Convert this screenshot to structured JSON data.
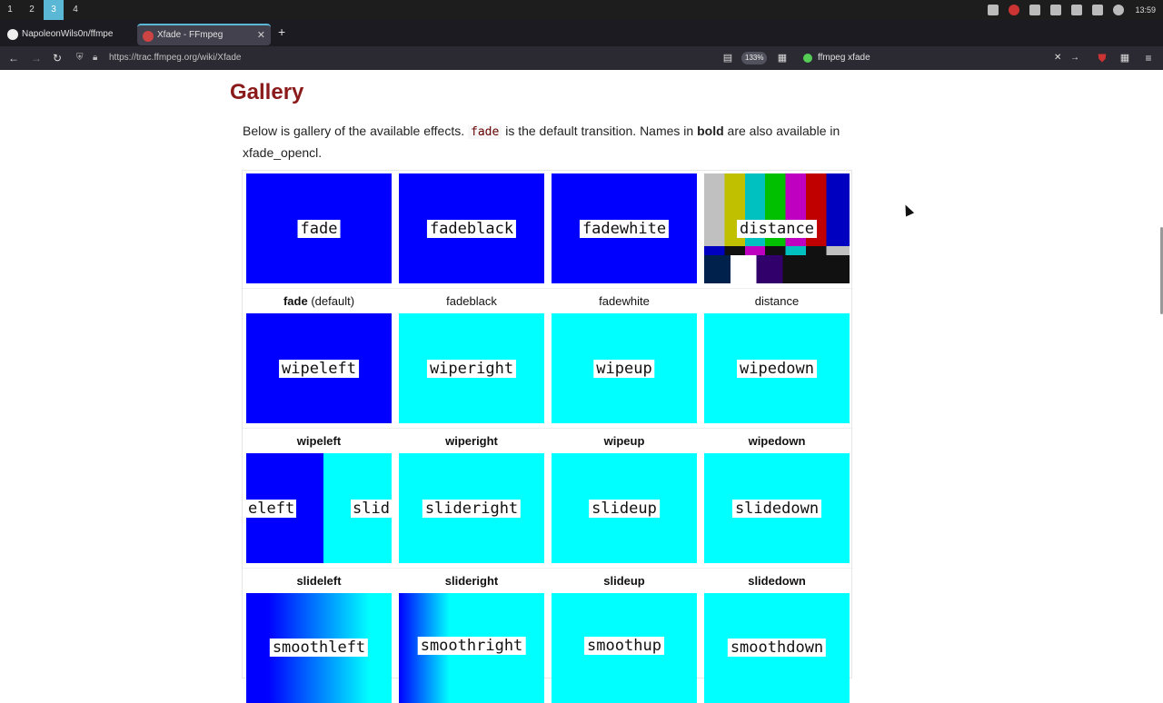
{
  "taskbar": {
    "workspaces": [
      "1",
      "2",
      "3",
      "4"
    ],
    "active_workspace": "3",
    "clock": "13:59"
  },
  "tabs": [
    {
      "label": "NapoleonWils0n/ffmpe",
      "active": false
    },
    {
      "label": "Xfade - FFmpeg",
      "active": true
    }
  ],
  "navbar": {
    "url": "https://trac.ffmpeg.org/wiki/Xfade",
    "zoom": "133%",
    "search": "ffmpeg xfade"
  },
  "page": {
    "heading": "Gallery",
    "intro_before": "Below is gallery of the available effects.",
    "intro_code": "fade",
    "intro_mid": "is the default transition. Names in",
    "intro_bold": "bold",
    "intro_after": "are also available in xfade_opencl."
  },
  "gallery": {
    "rows": [
      [
        {
          "tile": "fade",
          "caption": "fade",
          "caption_suffix": "(default)",
          "bold": true
        },
        {
          "tile": "fadeblack",
          "caption": "fadeblack",
          "bold": false
        },
        {
          "tile": "fadewhite",
          "caption": "fadewhite",
          "bold": false
        },
        {
          "tile": "distance",
          "caption": "distance",
          "bold": false
        }
      ],
      [
        {
          "tile": "wipeleft",
          "caption": "wipeleft",
          "bold": true
        },
        {
          "tile": "wiperight",
          "caption": "wiperight",
          "bold": true
        },
        {
          "tile": "wipeup",
          "caption": "wipeup",
          "bold": true
        },
        {
          "tile": "wipedown",
          "caption": "wipedown",
          "bold": true
        }
      ],
      [
        {
          "tile_left": "eleft",
          "tile_right": "slid",
          "caption": "slideleft",
          "bold": true
        },
        {
          "tile": "slideright",
          "caption": "slideright",
          "bold": true
        },
        {
          "tile": "slideup",
          "caption": "slideup",
          "bold": true
        },
        {
          "tile": "slidedown",
          "caption": "slidedown",
          "bold": true
        }
      ],
      [
        {
          "tile": "smoothleft"
        },
        {
          "tile": "smoothright"
        },
        {
          "tile": "smoothup"
        },
        {
          "tile": "smoothdown"
        }
      ]
    ]
  },
  "colors": {
    "blue": "#0000ff",
    "cyan": "#00ffff",
    "heading": "#8b1a1a"
  }
}
